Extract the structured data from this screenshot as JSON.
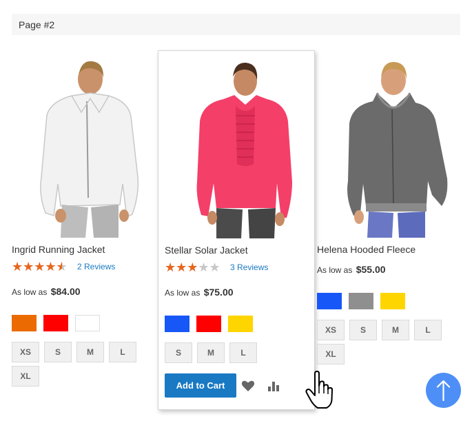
{
  "page_banner": "Page #2",
  "colors": {
    "accent": "#1979c3",
    "star": "#e8651c",
    "scroll_top": "#4d8ff7"
  },
  "products": [
    {
      "name": "Ingrid Running Jacket",
      "rating_percent": 90,
      "reviews": "2 Reviews",
      "price_prefix": "As low as",
      "price": "$84.00",
      "swatches": [
        "#ec6a02",
        "#ff0000",
        "#ffffff"
      ],
      "sizes": [
        "XS",
        "S",
        "M",
        "L",
        "XL"
      ]
    },
    {
      "name": "Stellar Solar Jacket",
      "rating_percent": 60,
      "reviews": "3 Reviews",
      "price_prefix": "As low as",
      "price": "$75.00",
      "swatches": [
        "#1857f7",
        "#ff0000",
        "#ffd500"
      ],
      "sizes": [
        "S",
        "M",
        "L"
      ],
      "add_to_cart": "Add to Cart",
      "wishlist_icon": "heart-icon",
      "compare_icon": "bar-chart-icon"
    },
    {
      "name": "Helena Hooded Fleece",
      "price_prefix": "As low as",
      "price": "$55.00",
      "swatches": [
        "#1857f7",
        "#8f8f8f",
        "#ffd500"
      ],
      "sizes": [
        "XS",
        "S",
        "M",
        "L",
        "XL"
      ]
    }
  ],
  "scroll_top_icon": "arrow-up-icon",
  "cursor_icon": "hand-pointer-icon"
}
